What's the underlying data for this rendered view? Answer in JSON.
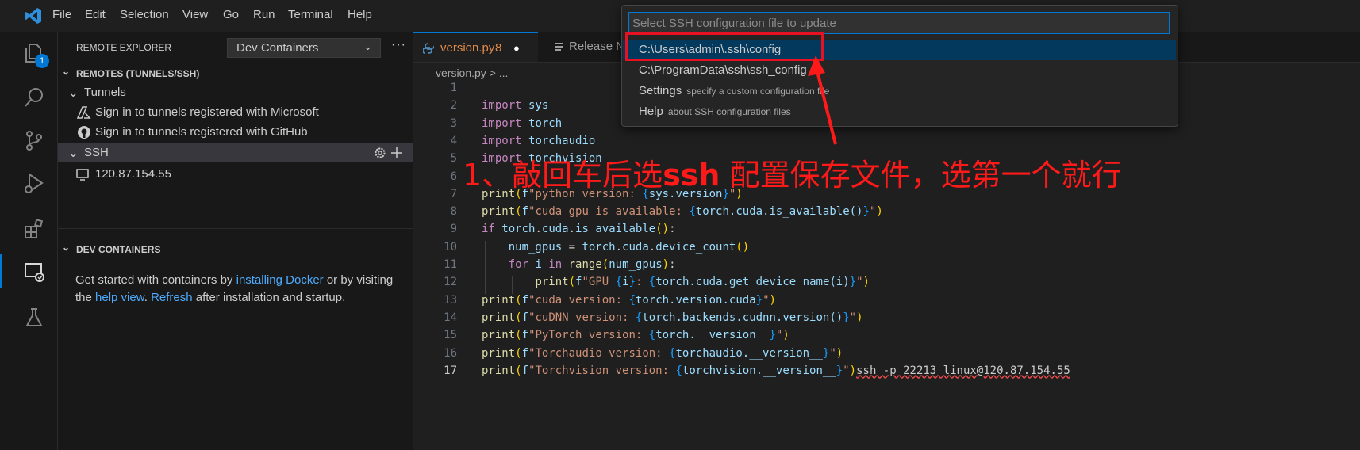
{
  "menubar": {
    "items": [
      "File",
      "Edit",
      "Selection",
      "View",
      "Go",
      "Run",
      "Terminal",
      "Help"
    ]
  },
  "activity_bar": {
    "explorer_badge": "1",
    "icons": [
      "files-icon",
      "search-icon",
      "source-control-icon",
      "run-debug-icon",
      "extensions-icon",
      "remote-explorer-icon",
      "testing-icon"
    ]
  },
  "sidebar": {
    "title": "REMOTE EXPLORER",
    "selector_value": "Dev Containers",
    "more": "···",
    "remotes_section": "REMOTES (TUNNELS/SSH)",
    "tunnels_label": "Tunnels",
    "tunnel_items": [
      "Sign in to tunnels registered with Microsoft",
      "Sign in to tunnels registered with GitHub"
    ],
    "ssh_label": "SSH",
    "ssh_hosts": [
      "120.87.154.55"
    ],
    "dev_section": "DEV CONTAINERS",
    "dev_text_1": "Get started with containers by ",
    "dev_link_1": "installing Docker",
    "dev_text_2": " or by visiting the ",
    "dev_link_2": "help view",
    "dev_text_3": ". ",
    "dev_link_3": "Refresh",
    "dev_text_4": " after installation and startup."
  },
  "editor": {
    "tabs": [
      {
        "label": "version.py",
        "problems": "8",
        "dirty": "●"
      },
      {
        "label": "Release N"
      }
    ],
    "breadcrumb": "version.py > ...",
    "current_line": 17,
    "lines": [
      {
        "n": "1",
        "t": ""
      },
      {
        "n": "2",
        "t": "import sys"
      },
      {
        "n": "3",
        "t": "import torch"
      },
      {
        "n": "4",
        "t": "import torchaudio"
      },
      {
        "n": "5",
        "t": "import torchvision"
      },
      {
        "n": "6",
        "t": ""
      },
      {
        "n": "7",
        "t": "print(f\"python version: {sys.version}\")"
      },
      {
        "n": "8",
        "t": "print(f\"cuda gpu is available: {torch.cuda.is_available()}\")"
      },
      {
        "n": "9",
        "t": "if torch.cuda.is_available():"
      },
      {
        "n": "10",
        "t": "    num_gpus = torch.cuda.device_count()"
      },
      {
        "n": "11",
        "t": "    for i in range(num_gpus):"
      },
      {
        "n": "12",
        "t": "        print(f\"GPU {i}: {torch.cuda.get_device_name(i)}\")"
      },
      {
        "n": "13",
        "t": "print(f\"cuda version: {torch.version.cuda}\")"
      },
      {
        "n": "14",
        "t": "print(f\"cuDNN version: {torch.backends.cudnn.version()}\")"
      },
      {
        "n": "15",
        "t": "print(f\"PyTorch version: {torch.__version__}\")"
      },
      {
        "n": "16",
        "t": "print(f\"Torchaudio version: {torchaudio.__version__}\")"
      },
      {
        "n": "17",
        "t": "print(f\"Torchvision version: {torchvision.__version__}\")ssh -p 22213 linux@120.87.154.55"
      }
    ]
  },
  "quick_pick": {
    "placeholder": "Select SSH configuration file to update",
    "items": [
      {
        "label": "C:\\Users\\admin\\.ssh\\config",
        "desc": ""
      },
      {
        "label": "C:\\ProgramData\\ssh\\ssh_config",
        "desc": ""
      },
      {
        "label": "Settings",
        "desc": "specify a custom configuration file"
      },
      {
        "label": "Help",
        "desc": "about SSH configuration files"
      }
    ]
  },
  "annotation": {
    "text_prefix": "1、敲回车后选",
    "text_bold": "ssh",
    "text_suffix": " 配置保存文件，选第一个就行",
    "color": "#ff1a1a"
  },
  "colors": {
    "accent": "#0078d4",
    "highlight_box": "#e81123"
  }
}
